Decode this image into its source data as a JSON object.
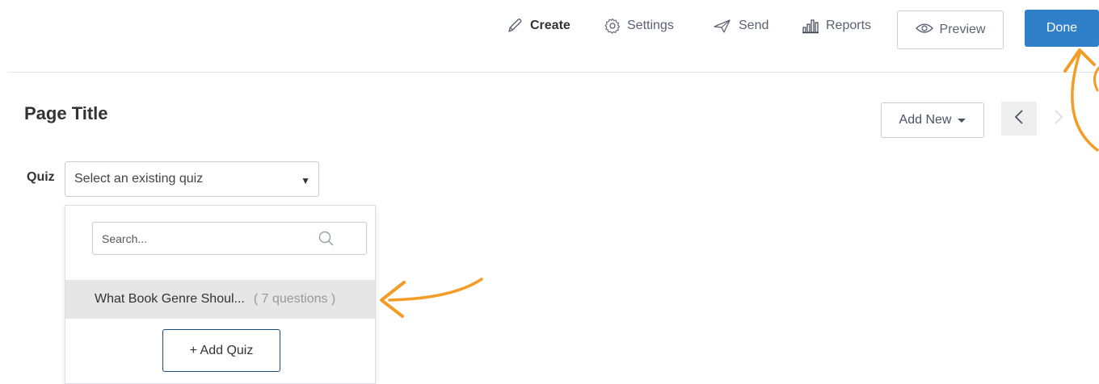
{
  "nav": {
    "create_label": "Create",
    "settings_label": "Settings",
    "send_label": "Send",
    "reports_label": "Reports",
    "preview_label": "Preview",
    "done_label": "Done"
  },
  "page": {
    "title": "Page Title",
    "add_new_label": "Add New"
  },
  "quiz": {
    "label": "Quiz",
    "select_value": "Select an existing quiz",
    "search_placeholder": "Search...",
    "options": [
      {
        "title": "What Book Genre Shoul...",
        "count": "( 7 questions )"
      }
    ],
    "add_quiz_label": "+ Add Quiz"
  },
  "icons": {
    "create": "pencil-icon",
    "settings": "gear-icon",
    "send": "paper-plane-icon",
    "reports": "bar-chart-icon",
    "preview": "eye-icon",
    "search": "search-icon"
  },
  "colors": {
    "primary": "#2f80c9",
    "annotation_arrow": "#f39c26",
    "selected_row": "#e6e6e6"
  }
}
